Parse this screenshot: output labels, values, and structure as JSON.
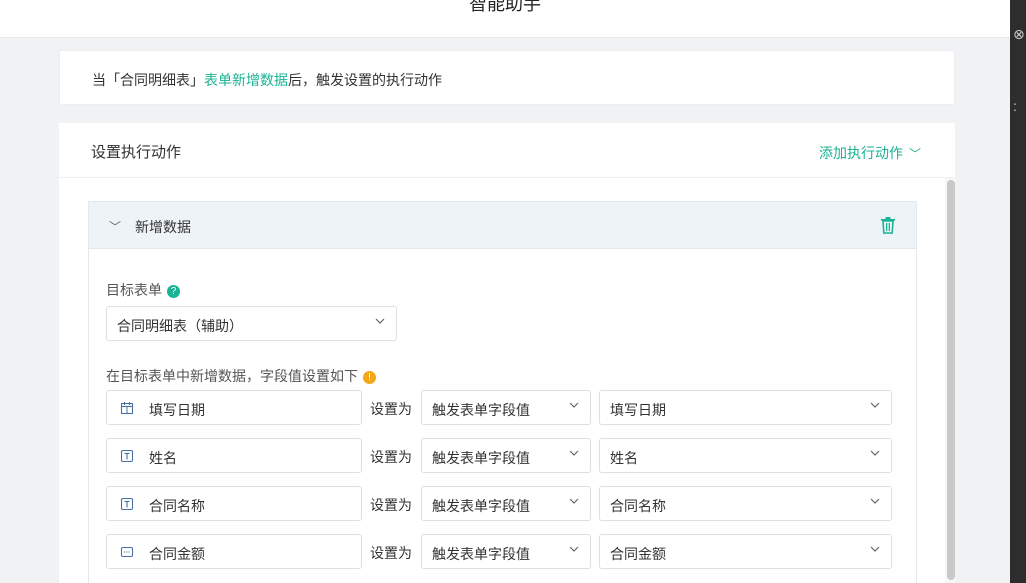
{
  "header": {
    "title": "智能助手"
  },
  "trigger": {
    "prefix": "当「合同明细表」",
    "highlight": "表单新增数据",
    "suffix": "后，触发设置的执行动作"
  },
  "actions": {
    "title": "设置执行动作",
    "add_label": "添加执行动作",
    "panel": {
      "title": "新增数据",
      "target_label": "目标表单",
      "target_value": "合同明细表（辅助）",
      "fields_label": "在目标表单中新增数据，字段值设置如下",
      "set_as_label": "设置为",
      "rows": [
        {
          "icon": "calendar-icon",
          "field": "填写日期",
          "source": "触发表单字段值",
          "target": "填写日期"
        },
        {
          "icon": "text-field-icon",
          "field": "姓名",
          "source": "触发表单字段值",
          "target": "姓名"
        },
        {
          "icon": "text-field-icon",
          "field": "合同名称",
          "source": "触发表单字段值",
          "target": "合同名称"
        },
        {
          "icon": "number-field-icon",
          "field": "合同金额",
          "source": "触发表单字段值",
          "target": "合同金额"
        }
      ]
    }
  },
  "colors": {
    "accent": "#1ab394",
    "warn": "#f3a917",
    "panel_header": "#eef3f8"
  }
}
